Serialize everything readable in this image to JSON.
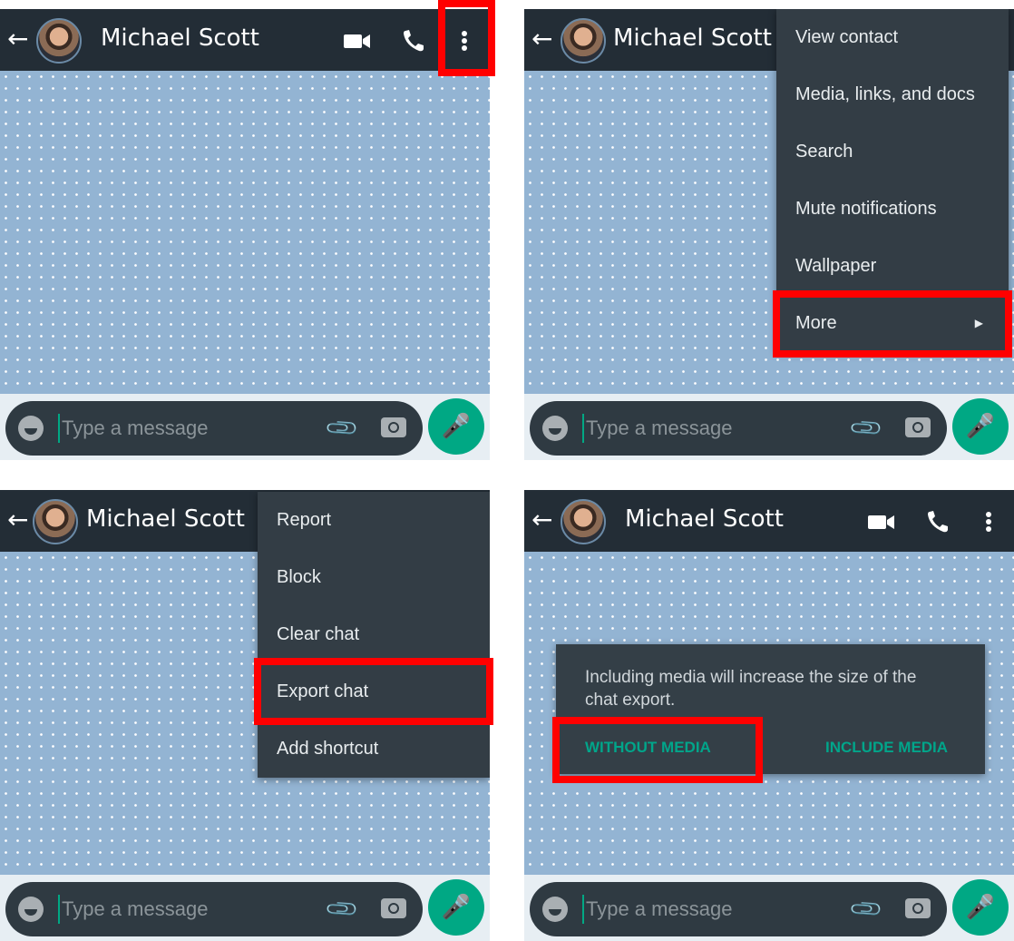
{
  "contact_name": "Michael Scott",
  "input_placeholder": "Type a message",
  "icons": {
    "back": "arrow-left-icon",
    "video": "video-camera-icon",
    "call": "phone-icon",
    "menu": "more-vert-icon",
    "emoji": "emoji-icon",
    "attach": "paperclip-icon",
    "camera": "camera-icon",
    "mic": "microphone-icon"
  },
  "menu1": {
    "items": [
      "View contact",
      "Media, links, and docs",
      "Search",
      "Mute notifications",
      "Wallpaper",
      "More"
    ]
  },
  "menu2": {
    "items": [
      "Report",
      "Block",
      "Clear chat",
      "Export chat",
      "Add shortcut"
    ]
  },
  "dialog": {
    "message": "Including media will increase the size of the chat export.",
    "without_media": "WITHOUT MEDIA",
    "include_media": "INCLUDE MEDIA"
  },
  "colors": {
    "header": "#232d36",
    "accent": "#00a884",
    "highlight": "#ff0000",
    "wallpaper": "#93b4d3"
  }
}
